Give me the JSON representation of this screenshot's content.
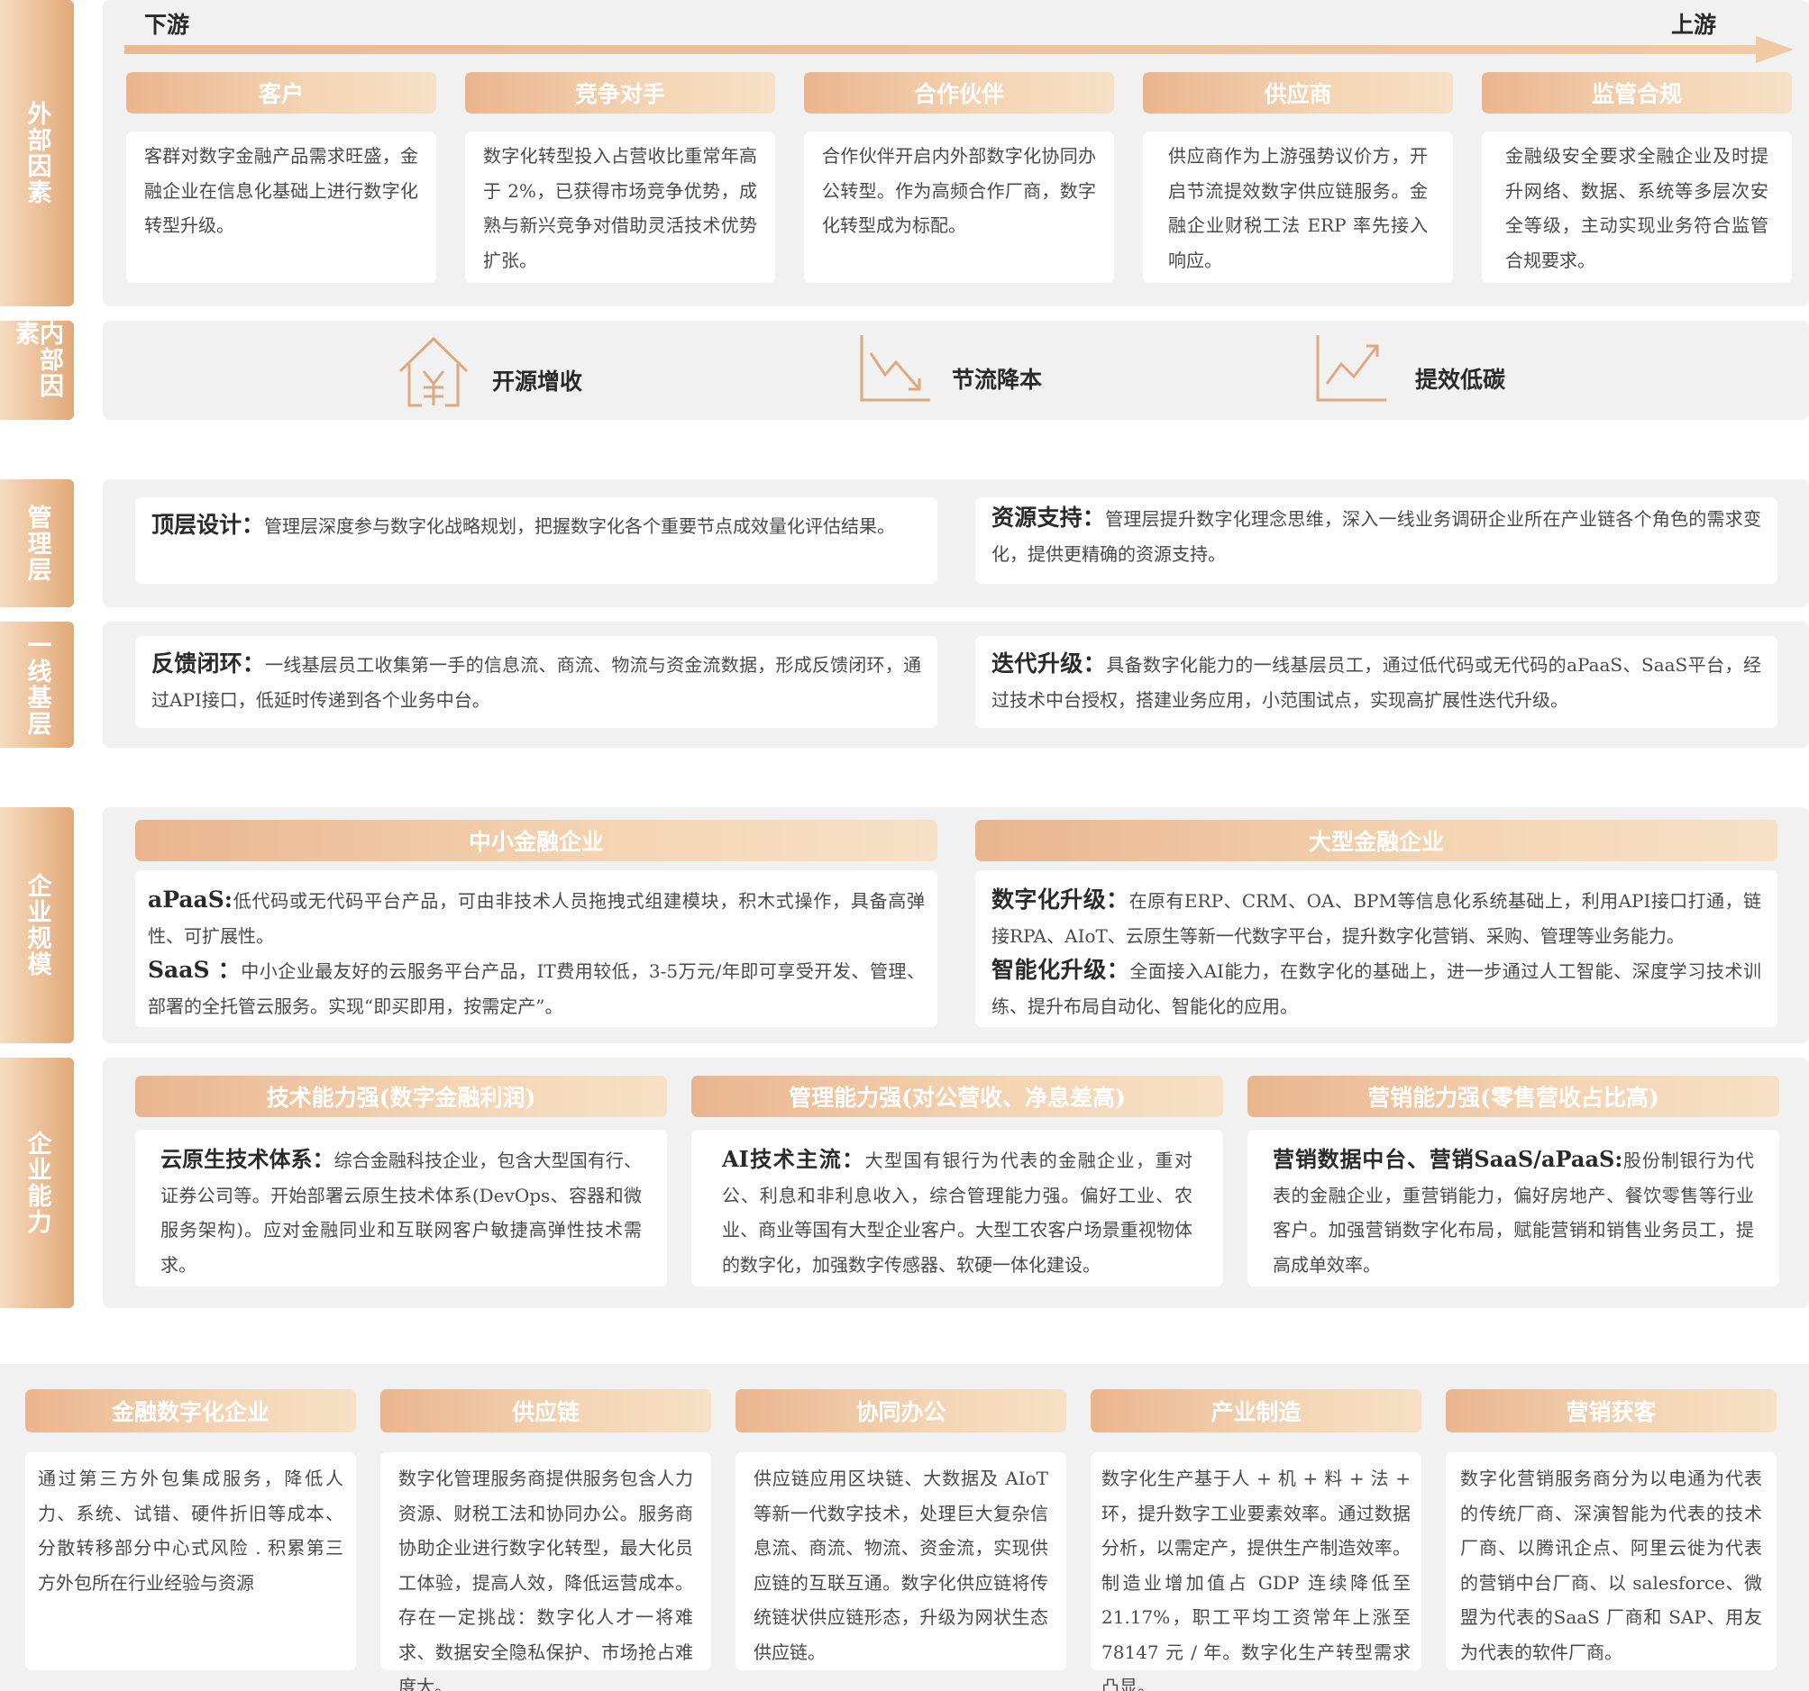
{
  "flow": {
    "left_label": "下游",
    "right_label": "上游"
  },
  "side_tabs": {
    "external": "外部因素",
    "internal": "内部因素",
    "management": "管理层",
    "frontline": "一线基层",
    "scale": "企业规模",
    "capability": "企业能力"
  },
  "external_factors": [
    {
      "title": "客户",
      "text": "客群对数字金融产品需求旺盛，金融企业在信息化基础上进行数字化转型升级。"
    },
    {
      "title": "竞争对手",
      "text": "数字化转型投入占营收比重常年高于 2%，已获得市场竞争优势，成熟与新兴竞争对借助灵活技术优势扩张。"
    },
    {
      "title": "合作伙伴",
      "text": "合作伙伴开启内外部数字化协同办公转型。作为高频合作厂商，数字化转型成为标配。"
    },
    {
      "title": "供应商",
      "text": "供应商作为上游强势议价方，开启节流提效数字供应链服务。金融企业财税工法 ERP 率先接入响应。"
    },
    {
      "title": "监管合规",
      "text": "金融级安全要求全融企业及时提升网络、数据、系统等多层次安全等级，主动实现业务符合监管合规要求。"
    }
  ],
  "internal_factors": [
    {
      "label": "开源增收",
      "icon": "house-yuan-icon"
    },
    {
      "label": "节流降本",
      "icon": "chart-down-icon"
    },
    {
      "label": "提效低碳",
      "icon": "chart-up-icon"
    }
  ],
  "management": [
    {
      "title": "顶层设计：",
      "text": "管理层深度参与数字化战略规划，把握数字化各个重要节点成效量化评估结果。"
    },
    {
      "title": "资源支持：",
      "text": "管理层提升数字化理念思维，深入一线业务调研企业所在产业链各个角色的需求变化，提供更精确的资源支持。"
    }
  ],
  "frontline": [
    {
      "title": "反馈闭环：",
      "text": "一线基层员工收集第一手的信息流、商流、物流与资金流数据，形成反馈闭环，通过API接口，低延时传递到各个业务中台。"
    },
    {
      "title": "迭代升级：",
      "text": "具备数字化能力的一线基层员工，通过低代码或无代码的aPaaS、SaaS平台，经过技术中台授权，搭建业务应用，小范围试点，实现高扩展性迭代升级。"
    }
  ],
  "scale": {
    "small": {
      "title": "中小金融企业",
      "items": [
        {
          "title": "aPaaS:",
          "text": "低代码或无代码平台产品，可由非技术人员拖拽式组建模块，积木式操作，具备高弹性、可扩展性。"
        },
        {
          "title": "SaaS ：",
          "text": "中小企业最友好的云服务平台产品，IT费用较低，3-5万元/年即可享受开发、管理、部署的全托管云服务。实现“即买即用，按需定产”。"
        }
      ]
    },
    "large": {
      "title": "大型金融企业",
      "items": [
        {
          "title": "数字化升级：",
          "text": "在原有ERP、CRM、OA、BPM等信息化系统基础上，利用API接口打通，链接RPA、AIoT、云原生等新一代数字平台，提升数字化营销、采购、管理等业务能力。"
        },
        {
          "title": "智能化升级：",
          "text": "全面接入AI能力，在数字化的基础上，进一步通过人工智能、深度学习技术训练、提升布局自动化、智能化的应用。"
        }
      ]
    }
  },
  "capability": [
    {
      "title": "技术能力强(数字金融利润)",
      "lead": "云原生技术体系：",
      "text": "综合金融科技企业，包含大型国有行、证券公司等。开始部署云原生技术体系(DevOps、容器和微服务架构)。应对金融同业和互联网客户敏捷高弹性技术需求。"
    },
    {
      "title": "管理能力强(对公营收、净息差高)",
      "lead": "AI技术主流：",
      "text": "大型国有银行为代表的金融企业，重对公、利息和非利息收入，综合管理能力强。偏好工业、农业、商业等国有大型企业客户。大型工农客户场景重视物体的数字化，加强数字传感器、软硬一体化建设。"
    },
    {
      "title": "营销能力强(零售营收占比高)",
      "lead": "营销数据中台、营销SaaS/aPaaS:",
      "text": "股份制银行为代表的金融企业，重营销能力，偏好房地产、餐饮零售等行业客户。加强营销数字化布局，赋能营销和销售业务员工，提高成单效率。"
    }
  ],
  "bottom": [
    {
      "title": "金融数字化企业",
      "text": "通过第三方外包集成服务，降低人力、系统、试错、硬件折旧等成本、分散转移部分中心式风险 . 积累第三方外包所在行业经验与资源"
    },
    {
      "title": "供应链",
      "text": "数字化管理服务商提供服务包含人力资源、财税工法和协同办公。服务商协助企业进行数字化转型，最大化员工体验，提高人效，降低运营成本。存在一定挑战：数字化人才一将难求、数据安全隐私保护、市场抢占难度大。"
    },
    {
      "title": "协同办公",
      "text": "供应链应用区块链、大数据及 AIoT 等新一代数字技术，处理巨大复杂信息流、商流、物流、资金流，实现供应链的互联互通。数字化供应链将传统链状供应链形态，升级为网状生态供应链。"
    },
    {
      "title": "产业制造",
      "text": "数字化生产基于人 + 机 + 料 + 法 + 环，提升数字工业要素效率。通过数据分析，以需定产，提供生产制造效率。制造业增加值占 GDP 连续降低至 21.17%，职工平均工资常年上涨至 78147 元 / 年。数字化生产转型需求凸显。"
    },
    {
      "title": "营销获客",
      "text": "数字化营销服务商分为以电通为代表的传统厂商、深演智能为代表的技术厂商、以腾讯企点、阿里云徙为代表的营销中台厂商、以 salesforce、微盟为代表的SaaS 厂商和 SAP、用友为代表的软件厂商。"
    }
  ]
}
